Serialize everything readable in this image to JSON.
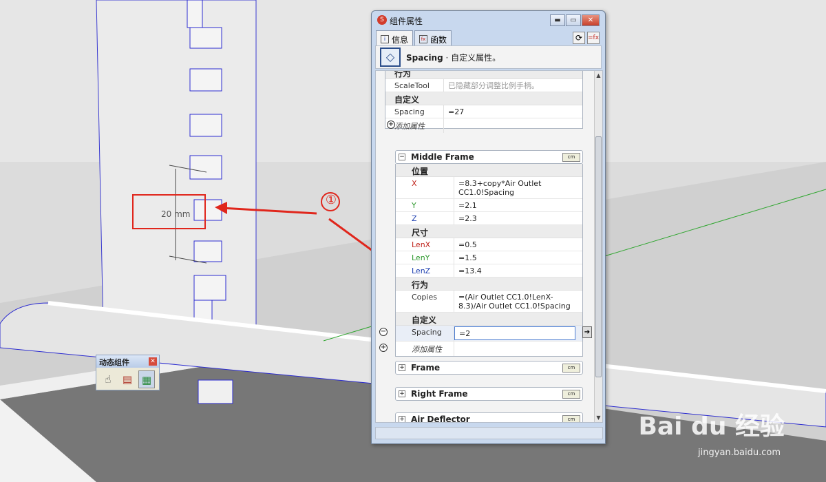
{
  "scene": {
    "dimension_label": "20 mm",
    "callout_number": "①"
  },
  "dc_toolbar": {
    "title": "动态组件",
    "close": "✕",
    "tools": [
      {
        "icon": "interact-hand-icon",
        "glyph": "☝"
      },
      {
        "icon": "component-options-icon",
        "glyph": "▤"
      },
      {
        "icon": "component-attributes-icon",
        "glyph": "▦"
      }
    ]
  },
  "dialog": {
    "title": "组件属性",
    "window_buttons": {
      "minimize": "▬",
      "maximize": "▭",
      "close": "✕"
    },
    "tabs": [
      {
        "label": "信息",
        "icon": "i"
      },
      {
        "label": "函数",
        "icon": "fx"
      }
    ],
    "header": {
      "name": "Spacing",
      "description": " · 自定义属性。"
    },
    "top_group": {
      "partial_section": "行为",
      "rows": [
        {
          "key": "ScaleTool",
          "value": "已隐藏部分调整比例手柄。"
        }
      ],
      "custom_section": "自定义",
      "custom_rows": [
        {
          "key": "Spacing",
          "value": "=27"
        }
      ],
      "add_attribute": "添加属性"
    },
    "middle_frame": {
      "name": "Middle Frame",
      "unit": "cm",
      "position_section": "位置",
      "position": [
        {
          "key": "X",
          "value": "=8.3+copy*Air Outlet CC1.0!Spacing"
        },
        {
          "key": "Y",
          "value": "=2.1"
        },
        {
          "key": "Z",
          "value": "=2.3"
        }
      ],
      "size_section": "尺寸",
      "size": [
        {
          "key": "LenX",
          "value": "=0.5"
        },
        {
          "key": "LenY",
          "value": "=1.5"
        },
        {
          "key": "LenZ",
          "value": "=13.4"
        }
      ],
      "behavior_section": "行为",
      "behavior": [
        {
          "key": "Copies",
          "value": "=(Air Outlet CC1.0!LenX-8.3)/Air Outlet CC1.0!Spacing"
        }
      ],
      "custom_section": "自定义",
      "custom": [
        {
          "key": "Spacing",
          "value": "=2"
        }
      ],
      "add_attribute": "添加属性"
    },
    "components": [
      {
        "name": "Frame",
        "unit": "cm"
      },
      {
        "name": "Right Frame",
        "unit": "cm"
      },
      {
        "name": "Air Deflector",
        "unit": "cm"
      }
    ]
  },
  "watermark": {
    "text": "Bai du 经验",
    "sub": "jingyan.baidu.com"
  }
}
